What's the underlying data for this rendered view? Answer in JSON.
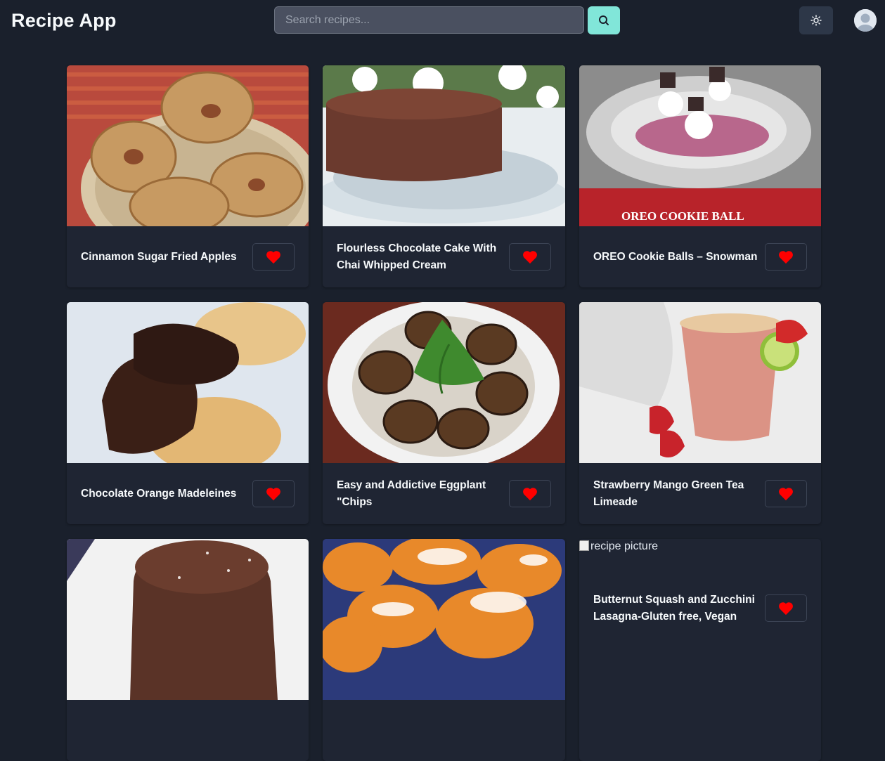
{
  "header": {
    "title": "Recipe App",
    "search_placeholder": "Search recipes...",
    "search_icon": "search-icon",
    "theme_icon": "sun-icon",
    "avatar_icon": "user-avatar"
  },
  "colors": {
    "background": "#1a202c",
    "card": "#1f2533",
    "accent": "#81e6d9",
    "heart": "#ff0000"
  },
  "recipes": [
    {
      "title": "Cinnamon Sugar Fried Apples",
      "image": "fried-apples-photo"
    },
    {
      "title": "Flourless Chocolate Cake With Chai Whipped Cream",
      "image": "chocolate-cake-photo"
    },
    {
      "title": "OREO Cookie Balls – Snowman",
      "image": "oreo-snowman-photo",
      "image_text": "OREO COOKIE BALL"
    },
    {
      "title": "Chocolate Orange Madeleines",
      "image": "madeleines-photo"
    },
    {
      "title": "Easy and Addictive Eggplant \"Chips",
      "image": "eggplant-chips-photo"
    },
    {
      "title": "Strawberry Mango Green Tea Limeade",
      "image": "limeade-photo"
    },
    {
      "title": "",
      "image": "chocolate-cookie-photo"
    },
    {
      "title": "",
      "image": "beignets-photo"
    },
    {
      "title": "Butternut Squash and Zucchini Lasagna-Gluten free, Vegan",
      "image_alt": "recipe picture"
    }
  ],
  "favorite_icon": "heart-icon"
}
